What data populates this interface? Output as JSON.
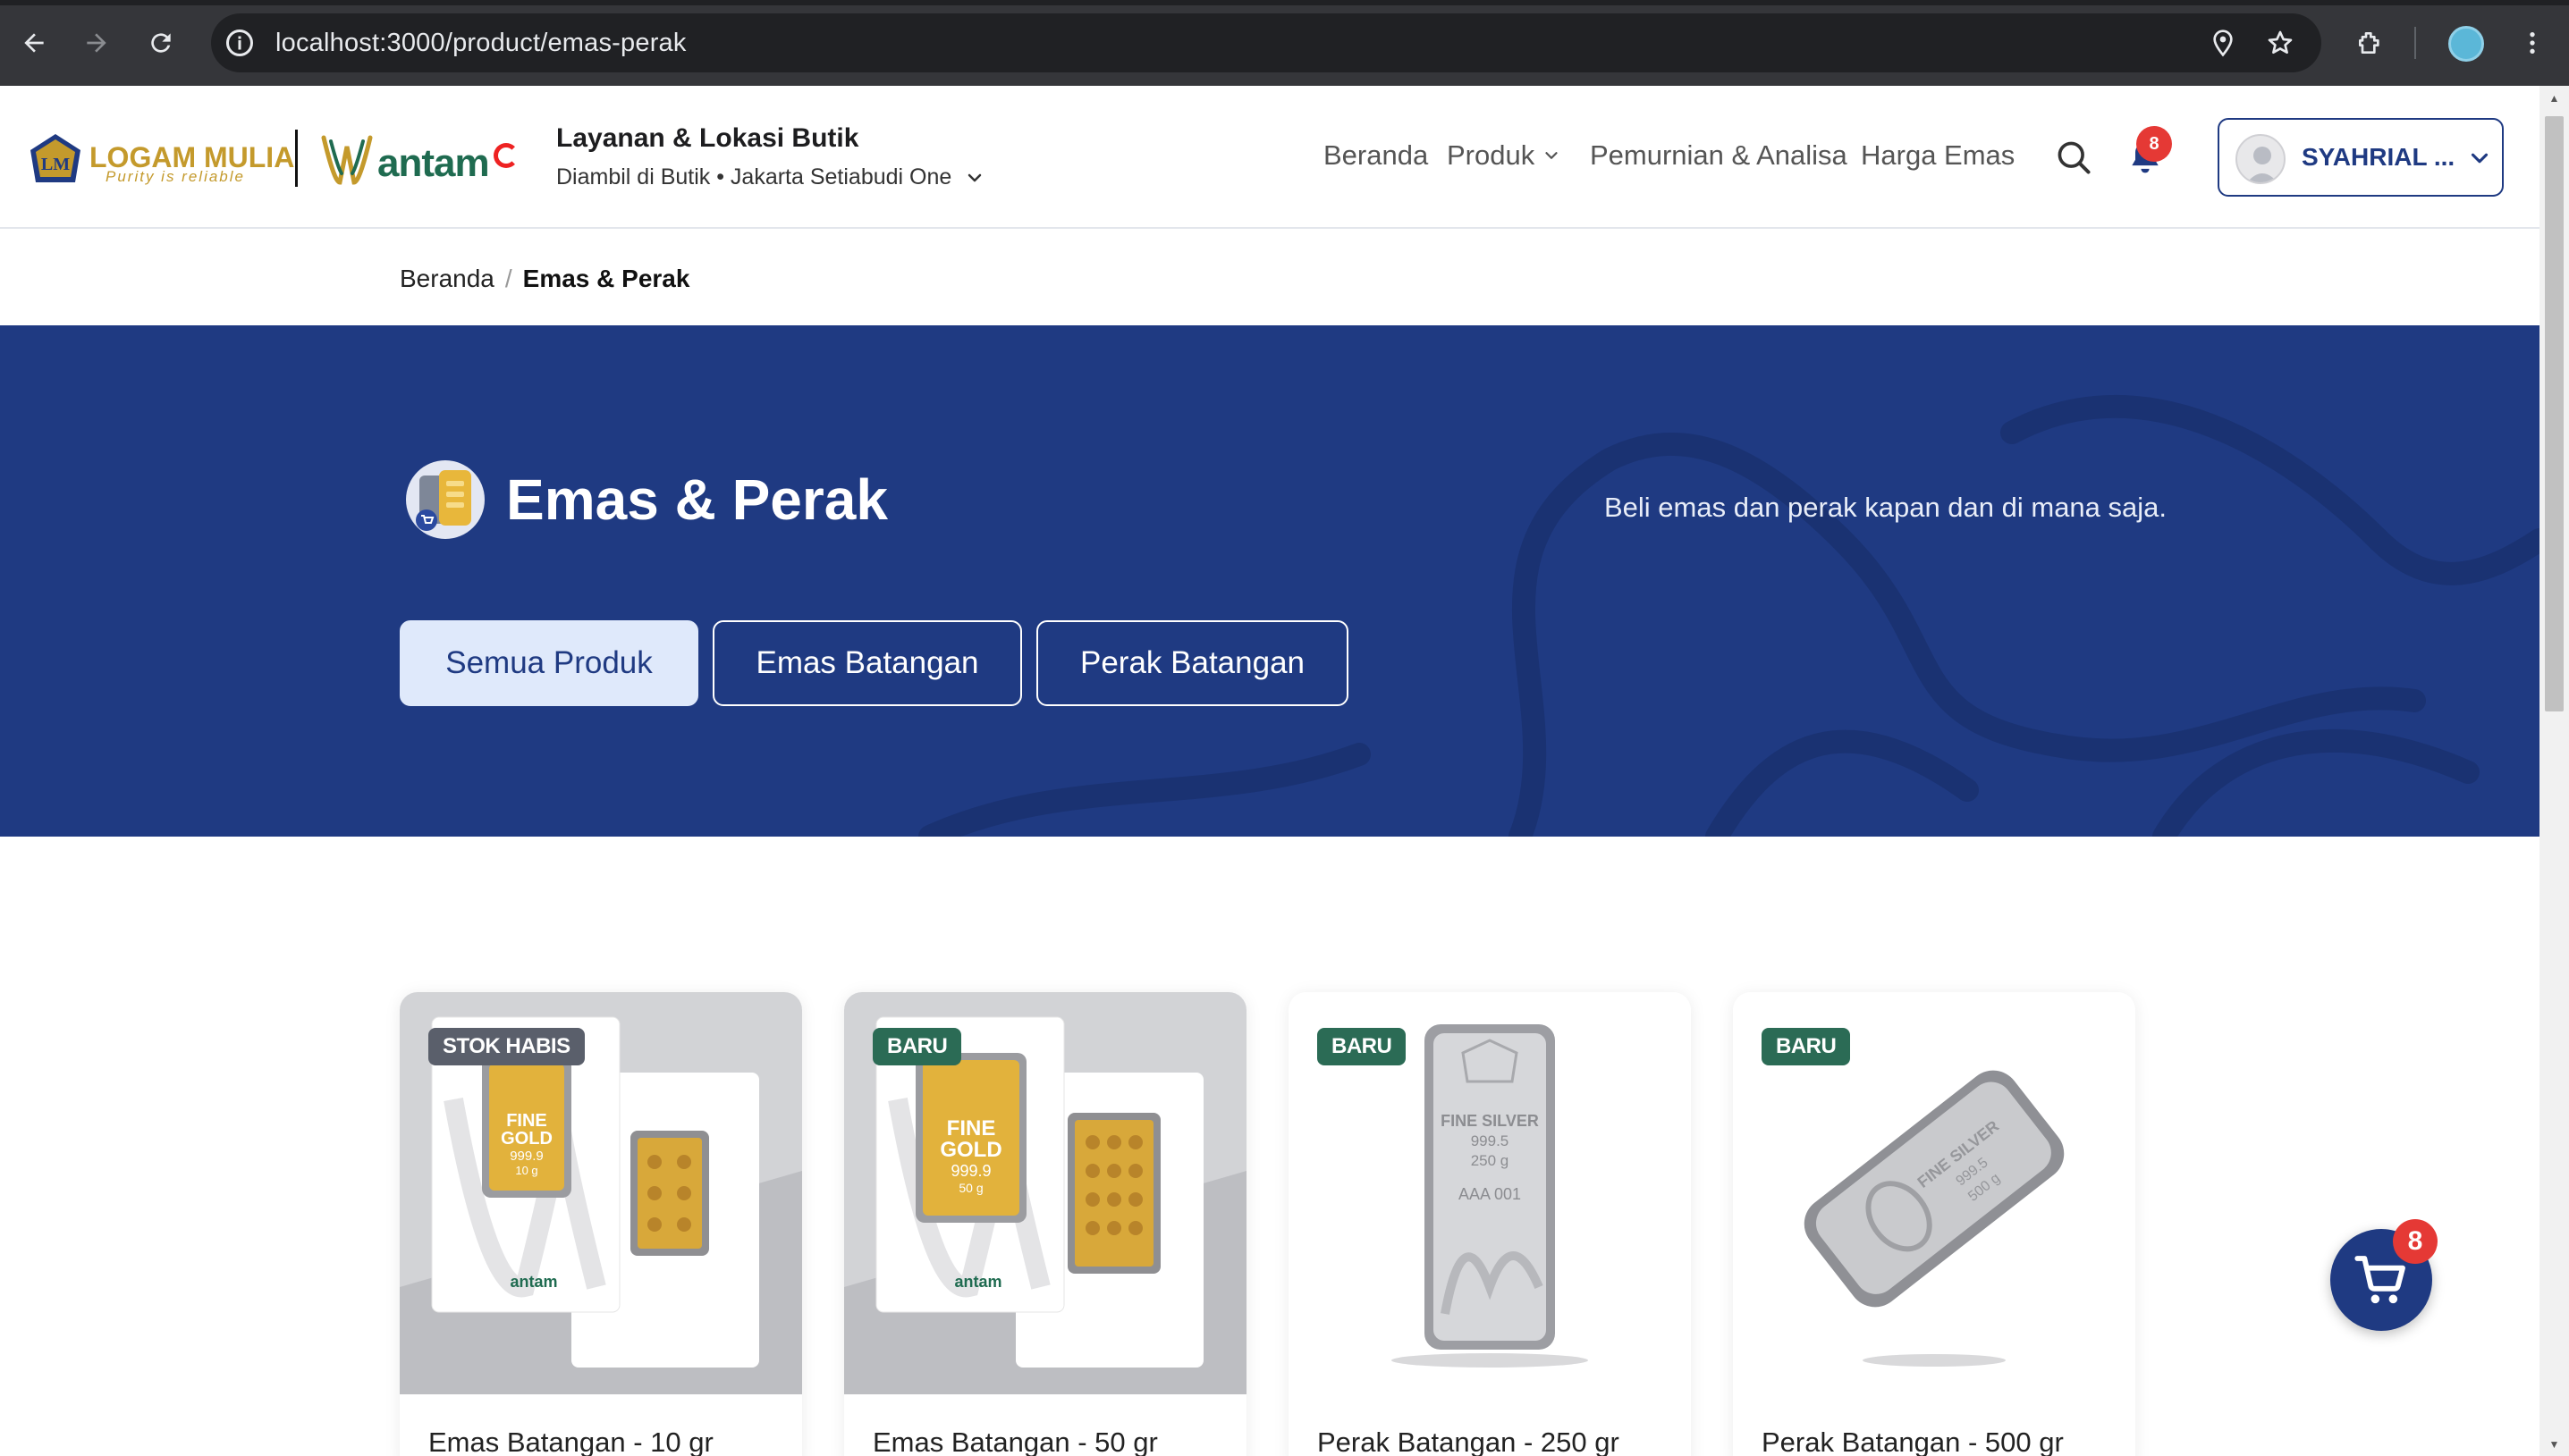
{
  "browser": {
    "url": "localhost:3000/product/emas-perak",
    "icons": [
      "back-arrow-icon",
      "forward-arrow-icon",
      "reload-icon",
      "site-info-icon",
      "location-pin-icon",
      "star-icon",
      "extensions-icon",
      "profile-icon",
      "more-vert-icon"
    ]
  },
  "header": {
    "brand_logam": "LOGAM MULIA",
    "brand_tagline": "Purity is reliable",
    "brand_antam": "antam",
    "service_title": "Layanan & Lokasi Butik",
    "service_subtitle": "Diambil di Butik • Jakarta Setiabudi One",
    "nav": {
      "beranda": "Beranda",
      "produk": "Produk",
      "pemurnian": "Pemurnian & Analisa",
      "harga": "Harga Emas"
    },
    "notification_count": "8",
    "user_name": "SYAHRIAL ..."
  },
  "breadcrumb": {
    "home": "Beranda",
    "separator": "/",
    "current": "Emas & Perak"
  },
  "hero": {
    "title": "Emas & Perak",
    "description": "Beli emas dan perak kapan dan di mana saja.",
    "filters": {
      "all": "Semua Produk",
      "gold": "Emas Batangan",
      "silver": "Perak Batangan"
    }
  },
  "products": [
    {
      "badge": "STOK HABIS",
      "name": "Emas Batangan - 10 gr",
      "bar_text": "FINE GOLD 999.9 10 g"
    },
    {
      "badge": "BARU",
      "name": "Emas Batangan - 50 gr",
      "bar_text": "FINE GOLD 999.9 50 g"
    },
    {
      "badge": "BARU",
      "name": "Perak Batangan - 250 gr",
      "bar_text": "FINE SILVER 999.5 250 g AAA 001"
    },
    {
      "badge": "BARU",
      "name": "Perak Batangan - 500 gr",
      "bar_text": "FINE SILVER 999.5 500 g"
    }
  ],
  "cart": {
    "count": "8"
  },
  "colors": {
    "primary": "#1f3a82",
    "light_blue": "#dfe9fb",
    "gold": "#c49a2c",
    "antam_green": "#1f6b50",
    "badge_red": "#e53935",
    "badge_green": "#2b6b55",
    "badge_gray": "#5a5f6b"
  }
}
